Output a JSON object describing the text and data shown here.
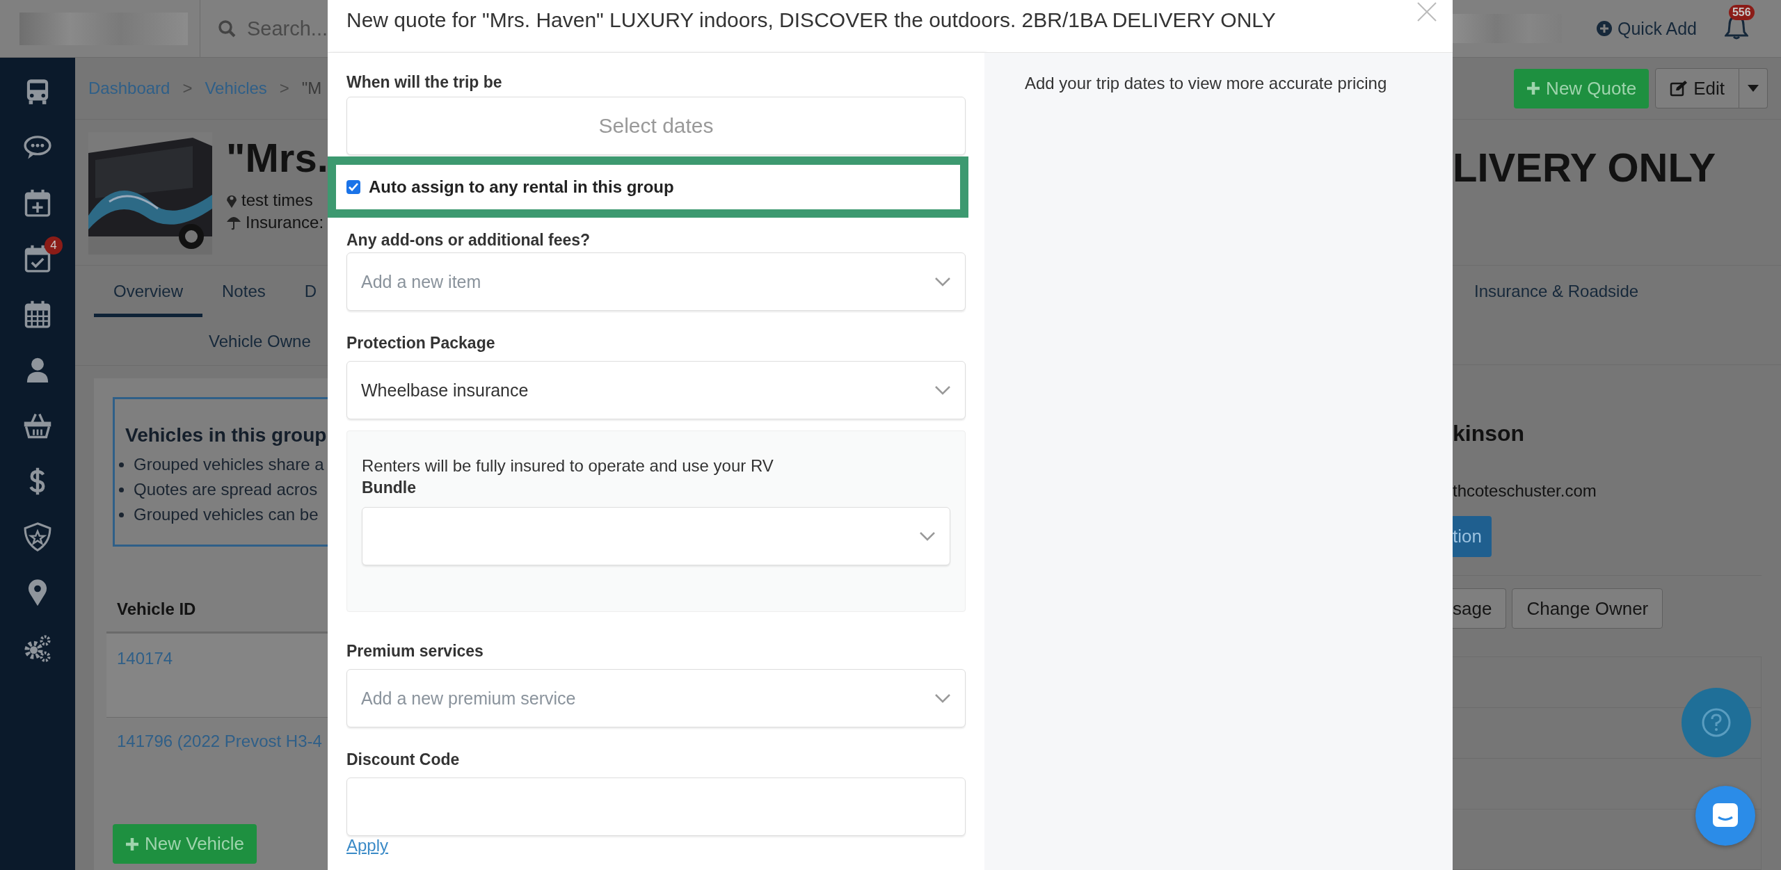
{
  "header": {
    "search_placeholder": "Search...",
    "quick_add": "Quick Add",
    "notification_count": "556"
  },
  "sidebar": {
    "tasks_badge": "4"
  },
  "breadcrumb": [
    "Dashboard",
    "Vehicles",
    "\"M"
  ],
  "breadcrumb_separator": ">",
  "vehicle": {
    "title_start": "\"Mrs.",
    "title_end": "LIVERY ONLY",
    "location": "test times",
    "insurance": "Insurance:"
  },
  "actions": {
    "new_quote": "New Quote",
    "edit": "Edit"
  },
  "tabs_left": [
    {
      "label": "Overview",
      "selected": true
    },
    {
      "label": "Notes",
      "selected": false
    },
    {
      "label": "D",
      "selected": false
    }
  ],
  "tabs_right": [
    {
      "label": "Insurance & Roadside",
      "selected": false
    }
  ],
  "tabs_row2": [
    {
      "label": "Vehicle Owne",
      "selected": false
    }
  ],
  "group_info": {
    "title": "Vehicles in this group",
    "bullets": [
      "Grouped vehicles share a",
      "Quotes are spread acros",
      "Grouped vehicles can be"
    ]
  },
  "vehicle_table": {
    "columns": [
      "Vehicle ID"
    ],
    "rows": [
      "140174",
      "141796 (2022 Prevost H3-4"
    ]
  },
  "new_vehicle": "New Vehicle",
  "owner": {
    "name": "kinson",
    "email": "thcoteschuster.com",
    "primary_button": "tion",
    "buttons": [
      "sage",
      "Change Owner"
    ]
  },
  "modal": {
    "title": "New quote for \"Mrs. Haven\" LUXURY indoors, DISCOVER the outdoors. 2BR/1BA DELIVERY ONLY",
    "trip_label": "When will the trip be",
    "dates_placeholder": "Select dates",
    "auto_assign": {
      "label": "Auto assign to any rental in this group",
      "checked": true
    },
    "addons": {
      "label": "Any add-ons or additional fees?",
      "placeholder": "Add a new item"
    },
    "protection": {
      "label": "Protection Package",
      "value": "Wheelbase insurance"
    },
    "protection_note": "Renters will be fully insured to operate and use your RV",
    "bundle_label": "Bundle",
    "premium": {
      "label": "Premium services",
      "placeholder": "Add a new premium service"
    },
    "discount": {
      "label": "Discount Code"
    },
    "apply": "Apply",
    "pricing_note": "Add your trip dates to view more accurate pricing"
  }
}
